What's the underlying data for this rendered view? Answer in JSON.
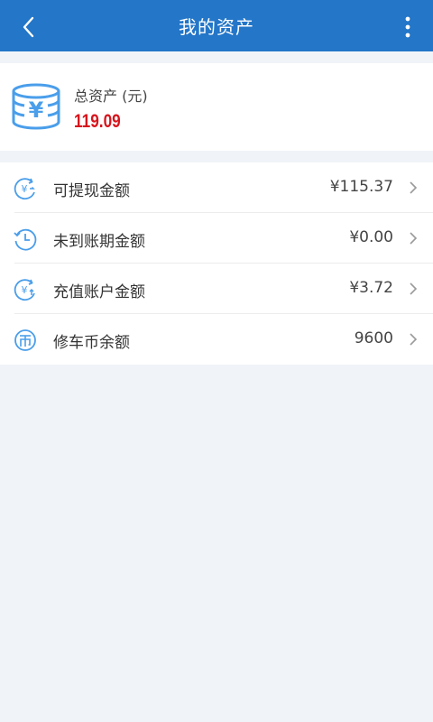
{
  "header": {
    "title": "我的资产",
    "back_icon": "chevron-left-icon",
    "more_icon": "more-vertical-icon",
    "color": "#2376c8"
  },
  "summary": {
    "icon": "coin-stack-yuan-icon",
    "label": "总资产 (元)",
    "value": "119.09",
    "value_color": "#d8141c"
  },
  "items": [
    {
      "icon": "yuan-withdraw-icon",
      "label": "可提现金额",
      "value": "¥115.37"
    },
    {
      "icon": "clock-history-icon",
      "label": "未到账期金额",
      "value": "¥0.00"
    },
    {
      "icon": "yuan-recharge-icon",
      "label": "充值账户金额",
      "value": "¥3.72"
    },
    {
      "icon": "coin-currency-icon",
      "label": "修车币余额",
      "value": "9600"
    }
  ],
  "colors": {
    "icon_blue": "#4a9eea",
    "background": "#f0f4f8"
  }
}
